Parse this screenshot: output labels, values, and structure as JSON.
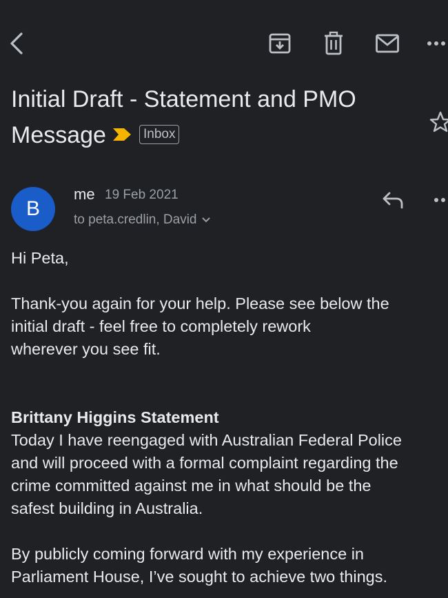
{
  "toolbar": {
    "icons": [
      "back-arrow-icon",
      "archive-icon",
      "trash-icon",
      "mail-icon",
      "more-icon"
    ]
  },
  "subject": {
    "line1": "Initial Draft - Statement and PMO",
    "line2": "Message",
    "label": "Inbox",
    "importance_color": "#f4b400"
  },
  "message": {
    "avatar_letter": "B",
    "avatar_color": "#1a5cc8",
    "sender": "me",
    "date": "19 Feb 2021",
    "recipients": "to peta.credlin, David"
  },
  "body": {
    "greeting": "Hi Peta,",
    "para1": [
      "Thank-you again for your help. Please see below the",
      "initial draft - feel free to completely rework",
      "wherever you see fit."
    ],
    "heading": "Brittany Higgins Statement",
    "para2": [
      "Today I have reengaged with Australian Federal Police",
      "and will proceed with a formal complaint regarding the",
      "crime committed against me in what should be the",
      "safest building in Australia."
    ],
    "para3": [
      "By publicly coming forward with my experience in",
      "Parliament House, I’ve sought to achieve two things."
    ]
  }
}
